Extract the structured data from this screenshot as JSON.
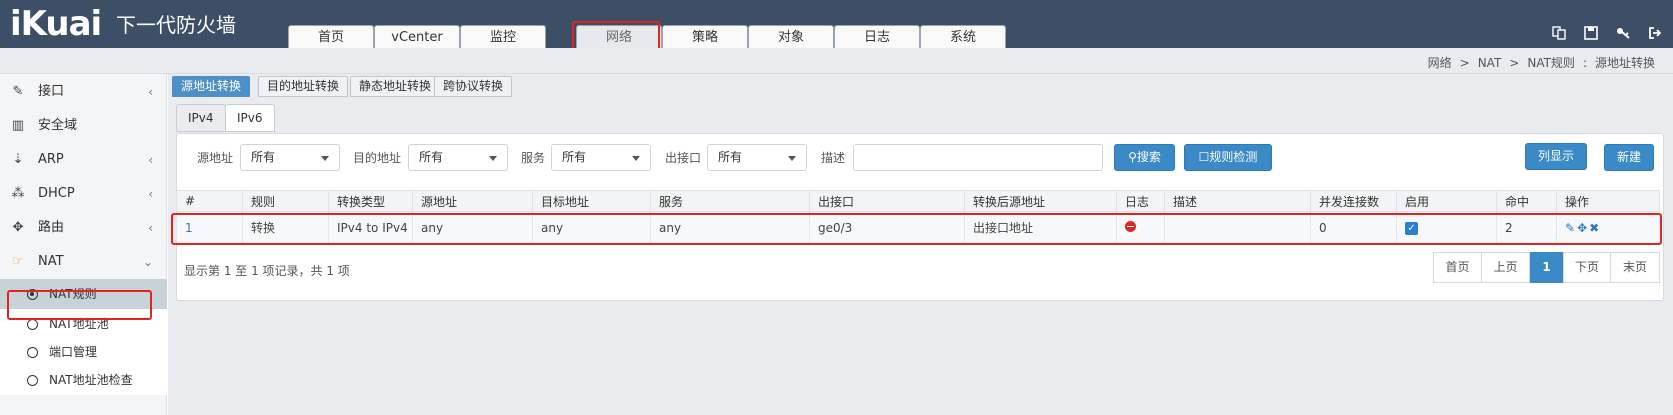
{
  "brand": {
    "logo": "iKuai",
    "product": "下一代防火墙"
  },
  "nav": [
    "首页",
    "vCenter",
    "监控",
    "网络",
    "策略",
    "对象",
    "日志",
    "系统"
  ],
  "nav_active": "网络",
  "toolbar_icons": [
    "translate-icon",
    "save-icon",
    "key-icon",
    "logout-icon"
  ],
  "breadcrumb": {
    "items": [
      "网络",
      "NAT",
      "NAT规则"
    ],
    "sep": ">",
    "colon": ":",
    "current": "源地址转换"
  },
  "sidebar": {
    "items": [
      {
        "label": "接口",
        "icon": "plug-icon",
        "chevron": "‹"
      },
      {
        "label": "安全域",
        "icon": "bank-icon",
        "chevron": ""
      },
      {
        "label": "ARP",
        "icon": "arp-icon",
        "chevron": "‹"
      },
      {
        "label": "DHCP",
        "icon": "network-icon",
        "chevron": "‹"
      },
      {
        "label": "路由",
        "icon": "arrows-icon",
        "chevron": "‹"
      },
      {
        "label": "NAT",
        "icon": "hand-icon",
        "chevron": "⌄"
      }
    ],
    "sub_items": [
      "NAT规则",
      "NAT地址池",
      "端口管理",
      "NAT地址池检查"
    ],
    "sub_selected": "NAT规则"
  },
  "sub_tabs": [
    "源地址转换",
    "目的地址转换",
    "静态地址转换",
    "跨协议转换"
  ],
  "ip_tabs": [
    "IPv4",
    "IPv6"
  ],
  "filters": {
    "src_label": "源地址",
    "src_value": "所有",
    "dst_label": "目的地址",
    "dst_value": "所有",
    "svc_label": "服务",
    "svc_value": "所有",
    "out_label": "出接口",
    "out_value": "所有",
    "desc_label": "描述",
    "desc_value": ""
  },
  "buttons": {
    "search": "搜索",
    "check": "规则检测",
    "list_view": "列显示",
    "new": "新建"
  },
  "table": {
    "columns": [
      "#",
      "规则",
      "转换类型",
      "源地址",
      "目标地址",
      "服务",
      "出接口",
      "转换后源地址",
      "日志",
      "描述",
      "并发连接数",
      "启用",
      "命中",
      "操作"
    ],
    "rows": [
      [
        "1",
        "转换",
        "IPv4 to IPv4",
        "any",
        "any",
        "any",
        "ge0/3",
        "出接口地址",
        "",
        "",
        "0",
        "",
        "2",
        ""
      ]
    ]
  },
  "summary": "显示第 1 至 1 项记录，共 1 项",
  "pagination": [
    "首页",
    "上页",
    "1",
    "下页",
    "末页"
  ],
  "colors": {
    "header_bg": "#3d4f67",
    "accent": "#3a8ac8",
    "highlight": "#e3231f"
  }
}
